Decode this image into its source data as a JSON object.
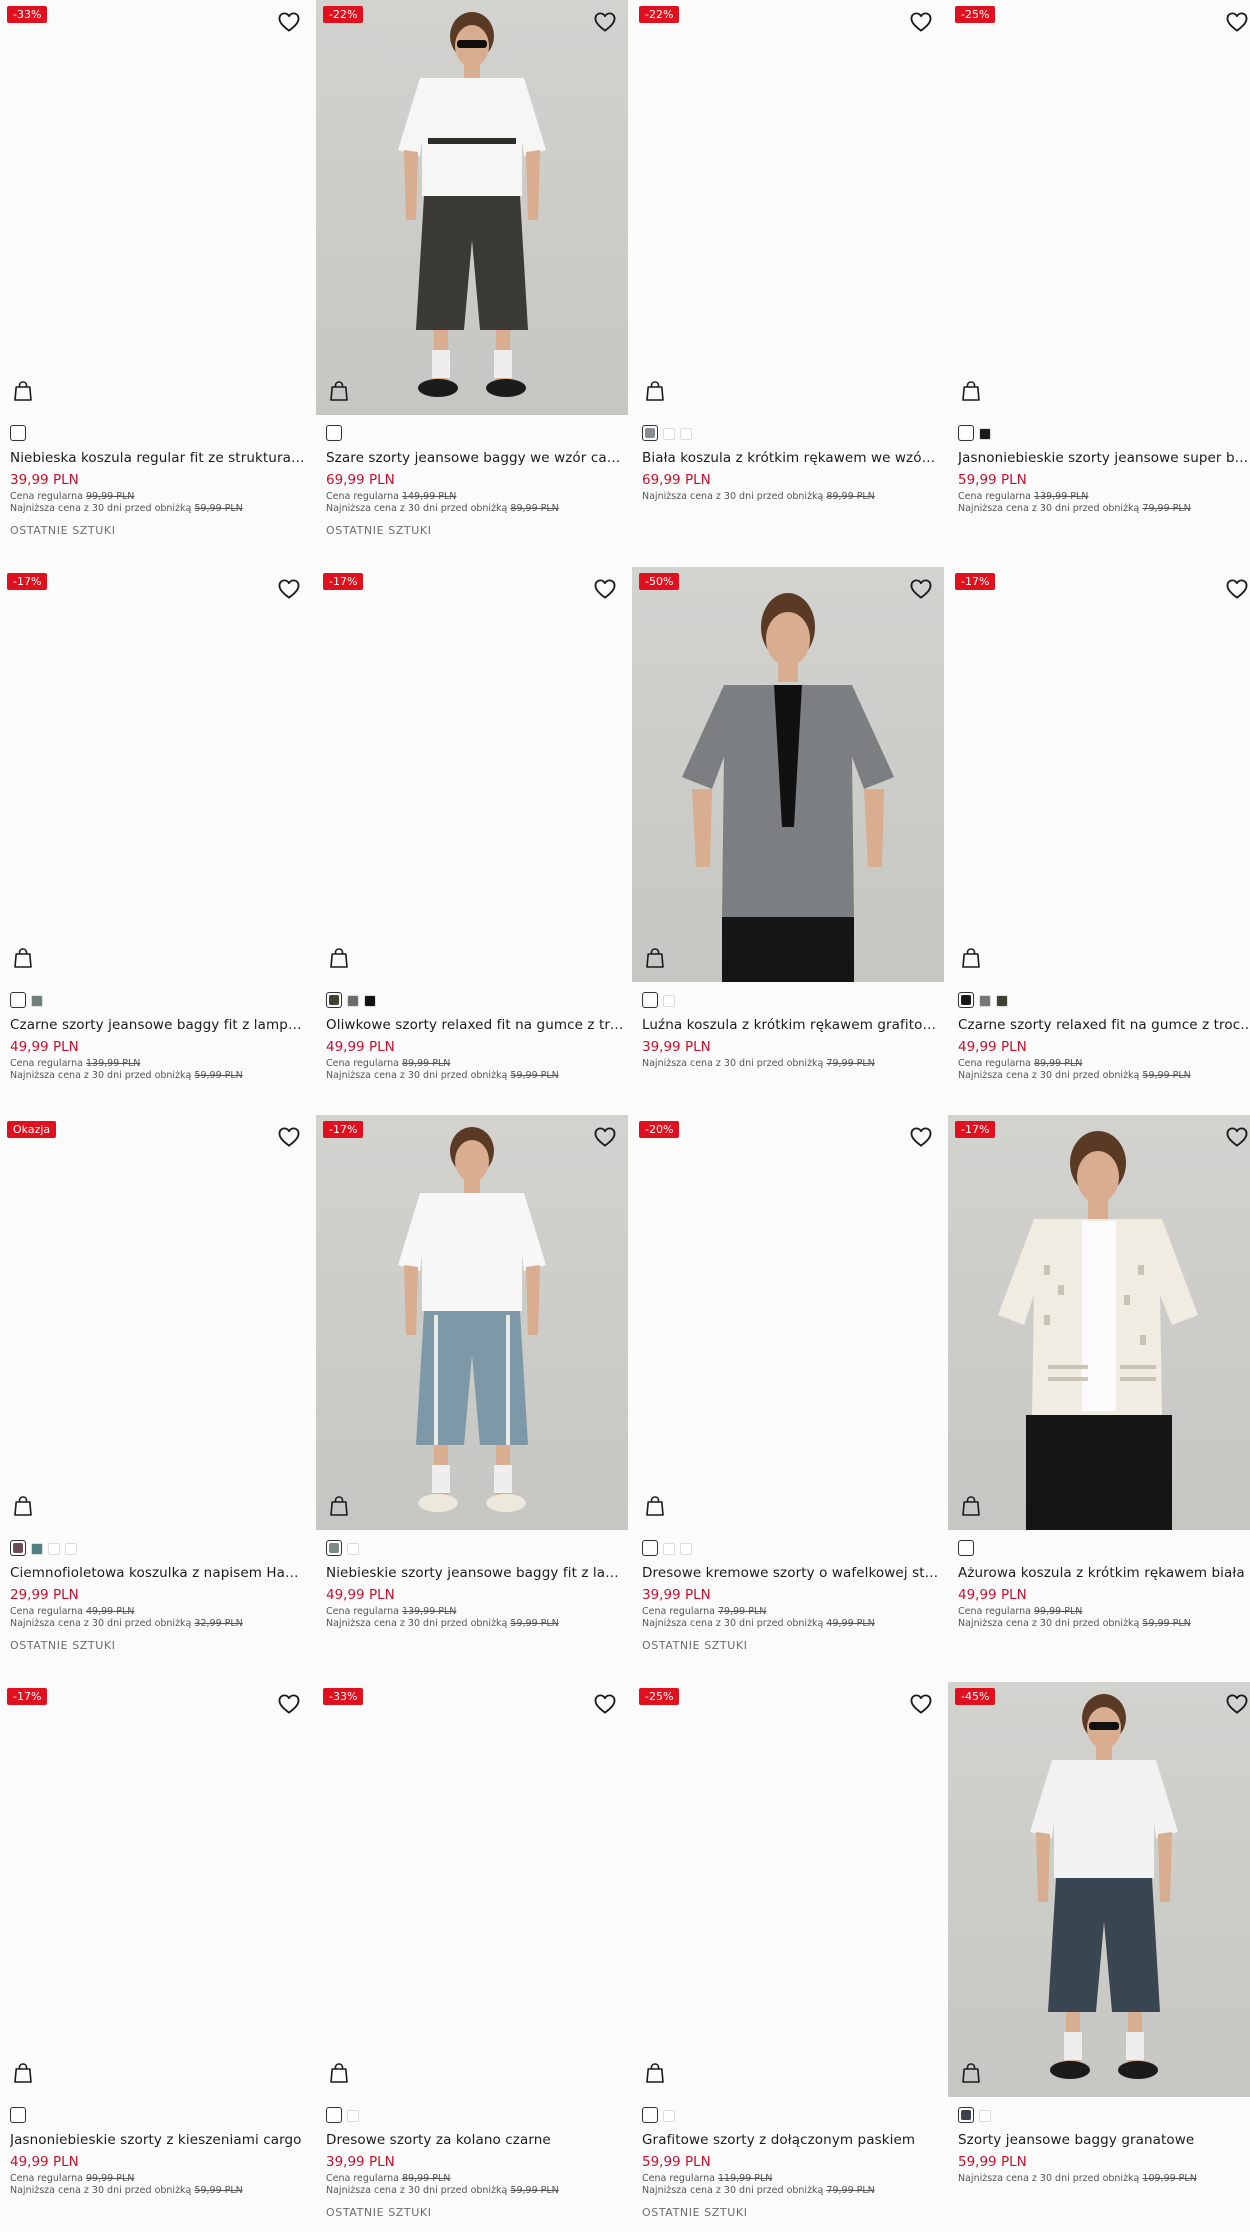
{
  "products": [
    {
      "badge": "-33%",
      "title": "Niebieska koszula regular fit ze strukturalnej tkaniny",
      "price": "39,99 PLN",
      "regular_label": "Cena regularna",
      "regular_price": "99,99 PLN",
      "lowest_label": "Najniższa cena z 30 dni przed obniżką",
      "lowest_price": "59,99 PLN",
      "last": "OSTATNIE SZTUKI",
      "swatches": [
        "#ffffff"
      ],
      "photo": ""
    },
    {
      "badge": "-22%",
      "title": "Szare szorty jeansowe baggy we wzór camo",
      "price": "69,99 PLN",
      "regular_label": "Cena regularna",
      "regular_price": "149,99 PLN",
      "lowest_label": "Najniższa cena z 30 dni przed obniżką",
      "lowest_price": "89,99 PLN",
      "last": "OSTATNIE SZTUKI",
      "swatches": [
        "#ffffff"
      ],
      "photo": "camo"
    },
    {
      "badge": "-22%",
      "title": "Biała koszula z krótkim rękawem we wzór roślinny",
      "price": "69,99 PLN",
      "regular_label": "",
      "regular_price": "",
      "lowest_label": "Najniższa cena z 30 dni przed obniżką",
      "lowest_price": "89,99 PLN",
      "last": "",
      "swatches": [
        "#8a8d92",
        "#ffffff",
        "#ffffff"
      ],
      "photo": ""
    },
    {
      "badge": "-25%",
      "title": "Jasnoniebieskie szorty jeansowe super baggy",
      "price": "59,99 PLN",
      "regular_label": "Cena regularna",
      "regular_price": "139,99 PLN",
      "lowest_label": "Najniższa cena z 30 dni przed obniżką",
      "lowest_price": "79,99 PLN",
      "last": "",
      "swatches": [
        "#ffffff",
        "#1a1a1a"
      ],
      "photo": ""
    },
    {
      "badge": "-17%",
      "title": "Czarne szorty jeansowe baggy fit z lampasami",
      "price": "49,99 PLN",
      "regular_label": "Cena regularna",
      "regular_price": "139,99 PLN",
      "lowest_label": "Najniższa cena z 30 dni przed obniżką",
      "lowest_price": "59,99 PLN",
      "last": "",
      "swatches": [
        "#ffffff",
        "#6f7f7a"
      ],
      "photo": ""
    },
    {
      "badge": "-17%",
      "title": "Oliwkowe szorty relaxed fit na gumce z troczkami",
      "price": "49,99 PLN",
      "regular_label": "Cena regularna",
      "regular_price": "89,99 PLN",
      "lowest_label": "Najniższa cena z 30 dni przed obniżką",
      "lowest_price": "59,99 PLN",
      "last": "",
      "swatches": [
        "#3e4232",
        "#6d6d6d",
        "#111111"
      ],
      "photo": ""
    },
    {
      "badge": "-50%",
      "title": "Luźna koszula z krótkim rękawem grafitowa",
      "price": "39,99 PLN",
      "regular_label": "",
      "regular_price": "",
      "lowest_label": "Najniższa cena z 30 dni przed obniżką",
      "lowest_price": "79,99 PLN",
      "last": "",
      "swatches": [
        "#ffffff",
        "#ffffff"
      ],
      "photo": "shirt"
    },
    {
      "badge": "-17%",
      "title": "Czarne szorty relaxed fit na gumce z troczkami",
      "price": "49,99 PLN",
      "regular_label": "Cena regularna",
      "regular_price": "89,99 PLN",
      "lowest_label": "Najniższa cena z 30 dni przed obniżką",
      "lowest_price": "59,99 PLN",
      "last": "",
      "swatches": [
        "#1a1a1a",
        "#777777",
        "#3f4232"
      ],
      "photo": ""
    },
    {
      "badge": "Okazja",
      "title": "Ciemnofioletowa koszulka z napisem Hawaii",
      "price": "29,99 PLN",
      "regular_label": "Cena regularna",
      "regular_price": "49,99 PLN",
      "lowest_label": "Najniższa cena z 30 dni przed obniżką",
      "lowest_price": "32,99 PLN",
      "last": "OSTATNIE SZTUKI",
      "swatches": [
        "#6b4d55",
        "#4f7f82",
        "#ffffff",
        "#ffffff"
      ],
      "photo": ""
    },
    {
      "badge": "-17%",
      "title": "Niebieskie szorty jeansowe baggy fit z lampasami",
      "price": "49,99 PLN",
      "regular_label": "Cena regularna",
      "regular_price": "139,99 PLN",
      "lowest_label": "Najniższa cena z 30 dni przed obniżką",
      "lowest_price": "59,99 PLN",
      "last": "",
      "swatches": [
        "#7a8c86",
        "#ffffff"
      ],
      "photo": "jeans"
    },
    {
      "badge": "-20%",
      "title": "Dresowe kremowe szorty o wafelkowej strukturze",
      "price": "39,99 PLN",
      "regular_label": "Cena regularna",
      "regular_price": "79,99 PLN",
      "lowest_label": "Najniższa cena z 30 dni przed obniżką",
      "lowest_price": "49,99 PLN",
      "last": "OSTATNIE SZTUKI",
      "swatches": [
        "#ffffff",
        "#ffffff",
        "#ffffff"
      ],
      "photo": ""
    },
    {
      "badge": "-17%",
      "title": "Ażurowa koszula z krótkim rękawem biała",
      "price": "49,99 PLN",
      "regular_label": "Cena regularna",
      "regular_price": "99,99 PLN",
      "lowest_label": "Najniższa cena z 30 dni przed obniżką",
      "lowest_price": "59,99 PLN",
      "last": "",
      "swatches": [
        "#ffffff"
      ],
      "photo": "lace"
    },
    {
      "badge": "-17%",
      "title": "Jasnoniebieskie szorty z kieszeniami cargo",
      "price": "49,99 PLN",
      "regular_label": "Cena regularna",
      "regular_price": "99,99 PLN",
      "lowest_label": "Najniższa cena z 30 dni przed obniżką",
      "lowest_price": "59,99 PLN",
      "last": "",
      "swatches": [
        "#ffffff"
      ],
      "photo": ""
    },
    {
      "badge": "-33%",
      "title": "Dresowe szorty za kolano czarne",
      "price": "39,99 PLN",
      "regular_label": "Cena regularna",
      "regular_price": "89,99 PLN",
      "lowest_label": "Najniższa cena z 30 dni przed obniżką",
      "lowest_price": "59,99 PLN",
      "last": "OSTATNIE SZTUKI",
      "swatches": [
        "#ffffff",
        "#ffffff"
      ],
      "photo": ""
    },
    {
      "badge": "-25%",
      "title": "Grafitowe szorty z dołączonym paskiem",
      "price": "59,99 PLN",
      "regular_label": "Cena regularna",
      "regular_price": "119,99 PLN",
      "lowest_label": "Najniższa cena z 30 dni przed obniżką",
      "lowest_price": "79,99 PLN",
      "last": "OSTATNIE SZTUKI",
      "swatches": [
        "#ffffff",
        "#ffffff"
      ],
      "photo": ""
    },
    {
      "badge": "-45%",
      "title": "Szorty jeansowe baggy granatowe",
      "price": "59,99 PLN",
      "regular_label": "",
      "regular_price": "",
      "lowest_label": "Najniższa cena z 30 dni przed obniżką",
      "lowest_price": "109,99 PLN",
      "last": "",
      "swatches": [
        "#3a3f4a",
        "#ffffff"
      ],
      "photo": "navy"
    }
  ]
}
